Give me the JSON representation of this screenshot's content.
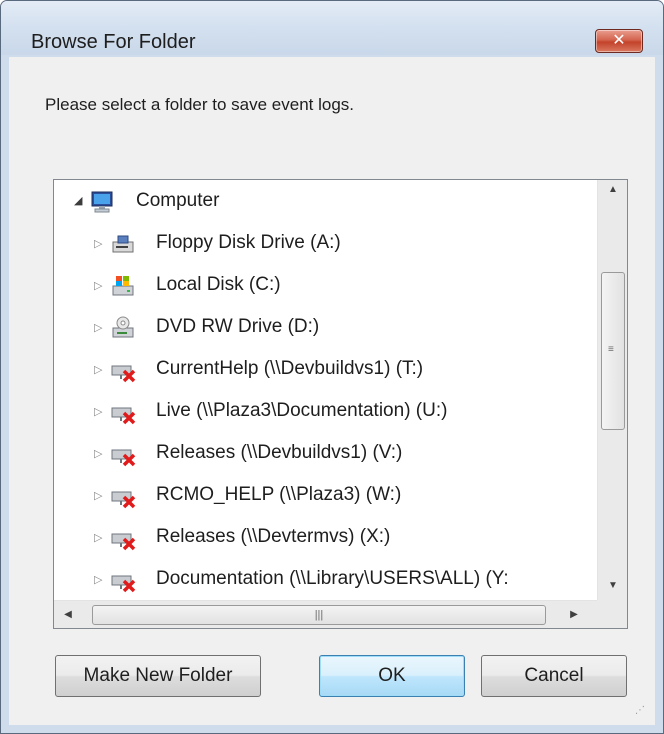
{
  "window": {
    "title": "Browse For Folder",
    "close_label": "✕"
  },
  "prompt": "Please select a folder to save event logs.",
  "tree": {
    "root": {
      "label": "Computer",
      "expanded": true,
      "icon": "computer-icon"
    },
    "items": [
      {
        "label": "Floppy Disk Drive (A:)",
        "icon": "floppy-drive-icon"
      },
      {
        "label": "Local Disk (C:)",
        "icon": "local-disk-icon"
      },
      {
        "label": "DVD RW Drive (D:)",
        "icon": "dvd-drive-icon"
      },
      {
        "label": "CurrentHelp (\\\\Devbuildvs1) (T:)",
        "icon": "disconnected-network-drive-icon"
      },
      {
        "label": "Live (\\\\Plaza3\\Documentation) (U:)",
        "icon": "disconnected-network-drive-icon"
      },
      {
        "label": "Releases (\\\\Devbuildvs1) (V:)",
        "icon": "disconnected-network-drive-icon"
      },
      {
        "label": "RCMO_HELP (\\\\Plaza3) (W:)",
        "icon": "disconnected-network-drive-icon"
      },
      {
        "label": "Releases (\\\\Devtermvs) (X:)",
        "icon": "disconnected-network-drive-icon"
      },
      {
        "label": "Documentation (\\\\Library\\USERS\\ALL) (Y:",
        "icon": "disconnected-network-drive-icon"
      }
    ]
  },
  "buttons": {
    "make_new_folder": "Make New Folder",
    "ok": "OK",
    "cancel": "Cancel"
  },
  "colors": {
    "title_bar": "#d3e0ef",
    "close_button": "#c3422a",
    "dialog_background": "#f0f0f0",
    "default_button_border": "#3c7fb1",
    "disconnected_x": "#e01b1b"
  }
}
